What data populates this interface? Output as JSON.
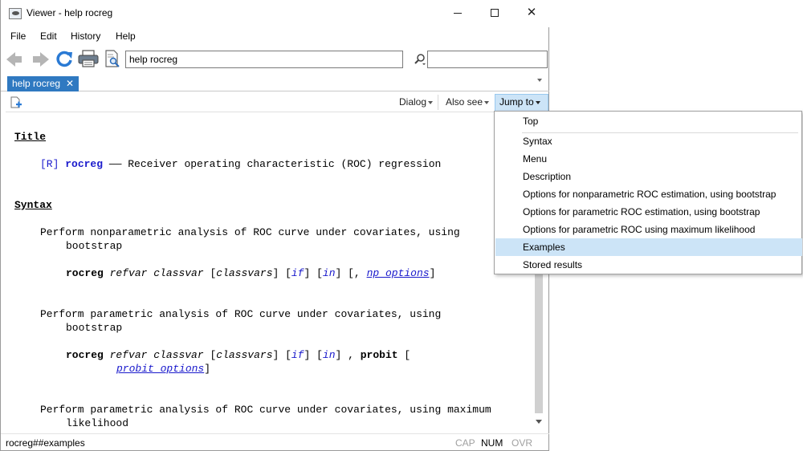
{
  "window": {
    "title": "Viewer - help rocreg"
  },
  "menubar": {
    "items": [
      "File",
      "Edit",
      "History",
      "Help"
    ]
  },
  "toolbar": {
    "command_value": "help rocreg",
    "search_value": ""
  },
  "tabs": [
    {
      "label": "help rocreg",
      "close": "✕"
    }
  ],
  "viewer_toolbar": {
    "dialog_label": "Dialog",
    "also_see_label": "Also see",
    "jump_to_label": "Jump to"
  },
  "content": {
    "title_heading": "Title",
    "title_ref": "[R]",
    "title_cmd": "rocreg",
    "title_desc": "—— Receiver operating characteristic (ROC) regression",
    "syntax_heading": "Syntax",
    "np_desc_1": "Perform nonparametric analysis of ROC curve under covariates, using",
    "np_desc_2": "bootstrap",
    "np_cmd": "rocreg",
    "np_args_1": "refvar classvar",
    "np_args_2": "[",
    "np_args_3": "classvars",
    "np_args_4": "] [",
    "np_args_5": "if",
    "np_args_6": "] [",
    "np_args_7": "in",
    "np_args_8": "] [,",
    "np_args_9": "np_options",
    "np_args_10": "]",
    "p_desc_1": "Perform parametric analysis of ROC curve under covariates, using",
    "p_desc_2": "bootstrap",
    "p_cmd": "rocreg",
    "p_args_1": "refvar classvar",
    "p_args_2": "[",
    "p_args_3": "classvars",
    "p_args_4": "] [",
    "p_args_5": "if",
    "p_args_6": "] [",
    "p_args_7": "in",
    "p_args_8": "] ,",
    "p_args_9": "probit",
    "p_args_10": "[",
    "p_args_11": "probit_options",
    "p_args_12": "]",
    "ml_desc_1": "Perform parametric analysis of ROC curve under covariates, using maximum",
    "ml_desc_2": "likelihood"
  },
  "statusbar": {
    "text": "rocreg##examples",
    "cap": "CAP",
    "num": "NUM",
    "ovr": "OVR"
  },
  "jump_menu": {
    "items": [
      "Top",
      "Syntax",
      "Menu",
      "Description",
      "Options for nonparametric ROC estimation, using bootstrap",
      "Options for parametric ROC estimation, using bootstrap",
      "Options for parametric ROC using maximum likelihood",
      "Examples",
      "Stored results"
    ],
    "highlighted": "Examples"
  },
  "colors": {
    "accent": "#2f79c1",
    "link": "#1a1acc",
    "highlight": "#cce4f7"
  }
}
